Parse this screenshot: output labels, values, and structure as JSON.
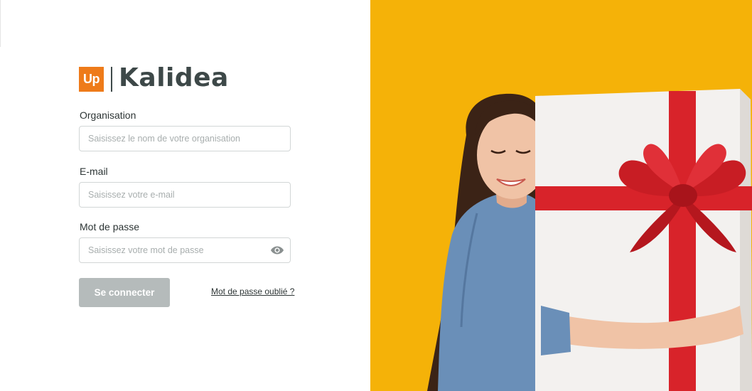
{
  "brand": {
    "up_label": "Up",
    "name": "Kalidea",
    "accent_color": "#ee7b1a",
    "text_color": "#3d4848"
  },
  "form": {
    "organisation": {
      "label": "Organisation",
      "placeholder": "Saisissez le nom de votre organisation",
      "value": ""
    },
    "email": {
      "label": "E-mail",
      "placeholder": "Saisissez votre e-mail",
      "value": ""
    },
    "password": {
      "label": "Mot de passe",
      "placeholder": "Saisissez votre mot de passe",
      "value": "",
      "toggle_icon": "eye-icon"
    },
    "submit_label": "Se connecter",
    "forgot_label": "Mot de passe oublié ?",
    "button_color": "#b5bbbb"
  },
  "hero": {
    "background_color": "#f5b208",
    "subject": "woman-hugging-gift-illustration"
  }
}
